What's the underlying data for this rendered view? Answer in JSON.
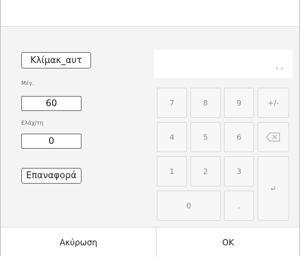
{
  "form": {
    "scale_button": "Κλίμακ_αυτ",
    "max_label": "Μέγ.",
    "max_value": "60",
    "min_label": "Ελάχ/τη",
    "min_value": "0",
    "reset_button": "Επαναφορά"
  },
  "keypad": {
    "display": "--",
    "keys": [
      "7",
      "8",
      "9",
      "+/-",
      "4",
      "5",
      "6",
      "1",
      "2",
      "3",
      "0",
      "."
    ],
    "backspace_icon": "backspace-icon",
    "enter_icon": "enter-icon"
  },
  "footer": {
    "cancel": "Ακύρωση",
    "ok": "OK"
  }
}
